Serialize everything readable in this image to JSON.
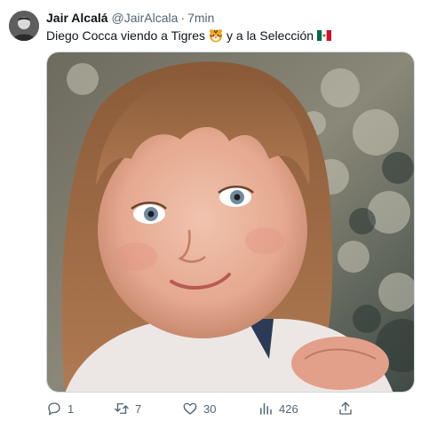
{
  "tweet": {
    "author_name": "Jair Alcalá",
    "handle": "@JairAlcala",
    "separator": "·",
    "time": "7min",
    "text_part1": "Diego Cocca viendo a Tigres",
    "text_part2": "y a la Selección",
    "emojis": [
      "tiger-face-emoji",
      "mexico-flag-emoji"
    ]
  },
  "media": {
    "description_icon": "photo-child-portrait"
  },
  "actions": {
    "reply_count": "1",
    "retweet_count": "7",
    "like_count": "30",
    "views_count": "426"
  },
  "colors": {
    "text_primary": "#0f1419",
    "text_secondary": "#536471",
    "border": "#cfd9de"
  }
}
